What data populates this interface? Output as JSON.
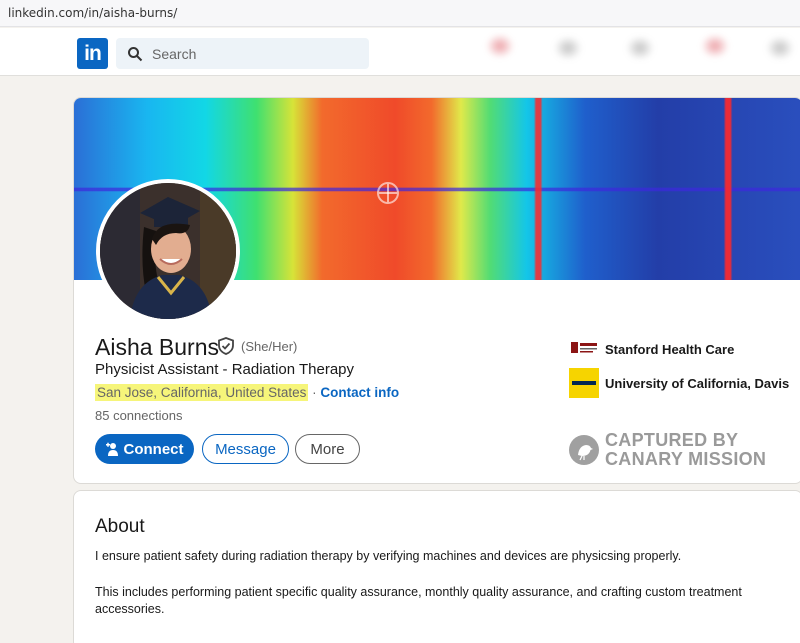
{
  "browser": {
    "url": "linkedin.com/in/aisha-burns/"
  },
  "nav": {
    "logo_text": "in",
    "search_placeholder": "Search"
  },
  "profile": {
    "name": "Aisha Burns",
    "pronouns": "(She/Her)",
    "headline": "Physicist Assistant - Radiation Therapy",
    "location": "San Jose, California, United States",
    "location_separator": " · ",
    "contact_link": "Contact info",
    "connections": "85 connections",
    "buttons": {
      "connect": "Connect",
      "message": "Message",
      "more": "More"
    },
    "organizations": [
      {
        "label": "Stanford Health Care",
        "logo": "stanford-logo"
      },
      {
        "label": "University of California, Davis",
        "logo": "ucdavis-logo"
      }
    ]
  },
  "watermark": {
    "line1": "CAPTURED BY",
    "line2": "CANARY MISSION"
  },
  "about": {
    "title": "About",
    "paragraphs": [
      "I ensure patient safety during radiation therapy by verifying machines and devices are physicsing properly.",
      "This includes performing patient specific quality assurance, monthly quality assurance, and crafting custom treatment accessories."
    ]
  },
  "colors": {
    "brand": "#0a66c2",
    "highlight": "#f6f57a",
    "background": "#f4f2ee"
  }
}
